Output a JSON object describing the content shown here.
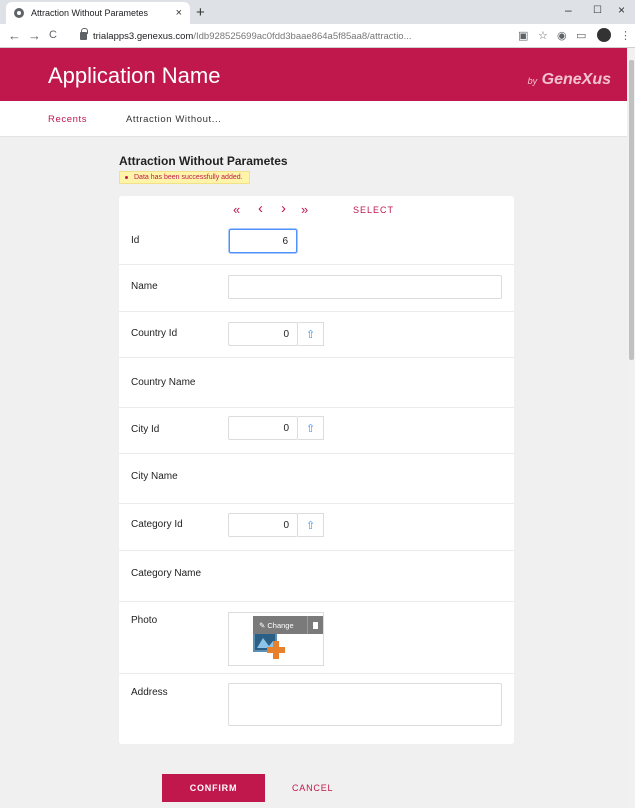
{
  "browser": {
    "tab_title": "Attraction Without Parametes",
    "tab_close": "×",
    "new_tab": "+",
    "url_host": "trialapps3.genexus.com",
    "url_path": "/Idb928525699ac0fdd3baae864a5f85aa8/attractio...",
    "back": "←",
    "forward": "→",
    "reload": "C",
    "minimize": "–",
    "maximize": "☐",
    "close": "×"
  },
  "header": {
    "app_name": "Application Name",
    "brand_by": "by",
    "brand_name": "GeneXus"
  },
  "breadcrumb": {
    "recents": "Recents",
    "current": "Attraction Without..."
  },
  "page": {
    "title": "Attraction Without Parametes",
    "notice": "Data has been successfully added."
  },
  "nav": {
    "first": "«",
    "prev": "‹",
    "next": "›",
    "last": "»",
    "select": "SELECT"
  },
  "form": {
    "id": {
      "label": "Id",
      "value": "6"
    },
    "name": {
      "label": "Name",
      "value": ""
    },
    "country_id": {
      "label": "Country Id",
      "value": "0"
    },
    "country_name": {
      "label": "Country Name"
    },
    "city_id": {
      "label": "City Id",
      "value": "0"
    },
    "city_name": {
      "label": "City Name"
    },
    "category_id": {
      "label": "Category Id",
      "value": "0"
    },
    "category_name": {
      "label": "Category Name"
    },
    "photo": {
      "label": "Photo",
      "change": "Change"
    },
    "address": {
      "label": "Address",
      "value": ""
    }
  },
  "actions": {
    "confirm": "CONFIRM",
    "cancel": "CANCEL"
  },
  "colors": {
    "brand": "#c0184d",
    "notice_bg": "#fff4a8",
    "prompt_icon": "#3d8ee8"
  }
}
